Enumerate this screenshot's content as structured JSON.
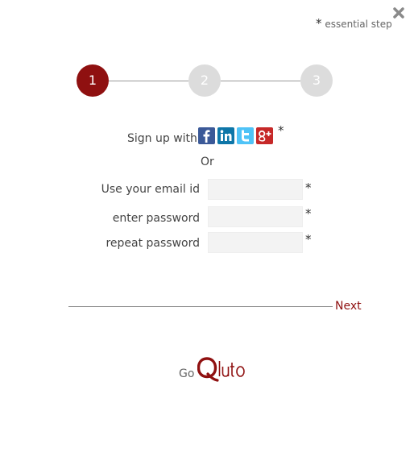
{
  "header": {
    "essential_note": "essential step",
    "required_marker": "*"
  },
  "stepper": {
    "steps": [
      {
        "label": "1",
        "active": true
      },
      {
        "label": "2",
        "active": false
      },
      {
        "label": "3",
        "active": false
      }
    ]
  },
  "signup": {
    "label": "Sign up with",
    "providers": [
      {
        "name": "facebook-icon",
        "color": "#3b5998"
      },
      {
        "name": "linkedin-icon",
        "color": "#0e76a8"
      },
      {
        "name": "twitter-icon",
        "color": "#4fc3f7"
      },
      {
        "name": "google-plus-icon",
        "color": "#c62828"
      }
    ],
    "required_marker": "*",
    "or_text": "Or"
  },
  "form": {
    "fields": [
      {
        "label": "Use your email id",
        "value": "",
        "required_marker": "*"
      },
      {
        "label": "enter password",
        "value": "",
        "required_marker": "*"
      },
      {
        "label": "repeat password",
        "value": "",
        "required_marker": "*"
      }
    ]
  },
  "footer": {
    "next_label": "Next",
    "go_text": "Go",
    "logo_text": "Qluto"
  },
  "colors": {
    "accent": "#8f1010",
    "step_inactive": "#dcdcdc"
  },
  "icons": {
    "close": "close-icon"
  }
}
